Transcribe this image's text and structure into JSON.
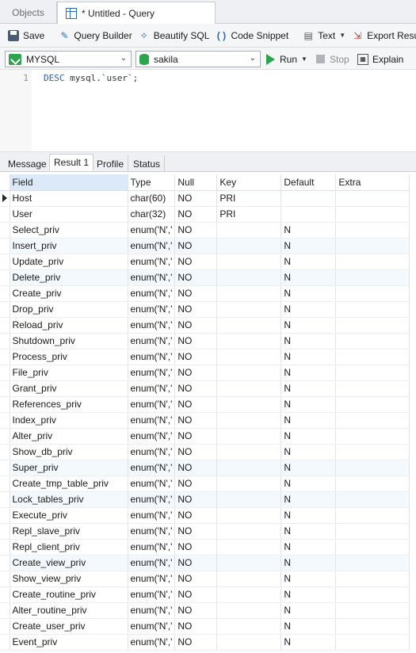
{
  "tabs": {
    "objects": "Objects",
    "query": "* Untitled - Query"
  },
  "toolbar": {
    "save": "Save",
    "query_builder": "Query Builder",
    "beautify": "Beautify SQL",
    "snippet": "Code Snippet",
    "text": "Text",
    "export": "Export Result"
  },
  "connection": {
    "name": "MYSQL",
    "database": "sakila",
    "run": "Run",
    "stop": "Stop",
    "explain": "Explain"
  },
  "editor": {
    "line": "1",
    "keyword": "DESC",
    "rest": " mysql.`user`;"
  },
  "result_tabs": [
    "Message",
    "Result 1",
    "Profile",
    "Status"
  ],
  "grid": {
    "columns": [
      "Field",
      "Type",
      "Null",
      "Key",
      "Default",
      "Extra"
    ],
    "rows": [
      [
        "Host",
        "char(60)",
        "NO",
        "PRI",
        "",
        ""
      ],
      [
        "User",
        "char(32)",
        "NO",
        "PRI",
        "",
        ""
      ],
      [
        "Select_priv",
        "enum('N','",
        "NO",
        "",
        "N",
        ""
      ],
      [
        "Insert_priv",
        "enum('N','",
        "NO",
        "",
        "N",
        ""
      ],
      [
        "Update_priv",
        "enum('N','",
        "NO",
        "",
        "N",
        ""
      ],
      [
        "Delete_priv",
        "enum('N','",
        "NO",
        "",
        "N",
        ""
      ],
      [
        "Create_priv",
        "enum('N','",
        "NO",
        "",
        "N",
        ""
      ],
      [
        "Drop_priv",
        "enum('N','",
        "NO",
        "",
        "N",
        ""
      ],
      [
        "Reload_priv",
        "enum('N','",
        "NO",
        "",
        "N",
        ""
      ],
      [
        "Shutdown_priv",
        "enum('N','",
        "NO",
        "",
        "N",
        ""
      ],
      [
        "Process_priv",
        "enum('N','",
        "NO",
        "",
        "N",
        ""
      ],
      [
        "File_priv",
        "enum('N','",
        "NO",
        "",
        "N",
        ""
      ],
      [
        "Grant_priv",
        "enum('N','",
        "NO",
        "",
        "N",
        ""
      ],
      [
        "References_priv",
        "enum('N','",
        "NO",
        "",
        "N",
        ""
      ],
      [
        "Index_priv",
        "enum('N','",
        "NO",
        "",
        "N",
        ""
      ],
      [
        "Alter_priv",
        "enum('N','",
        "NO",
        "",
        "N",
        ""
      ],
      [
        "Show_db_priv",
        "enum('N','",
        "NO",
        "",
        "N",
        ""
      ],
      [
        "Super_priv",
        "enum('N','",
        "NO",
        "",
        "N",
        ""
      ],
      [
        "Create_tmp_table_priv",
        "enum('N','",
        "NO",
        "",
        "N",
        ""
      ],
      [
        "Lock_tables_priv",
        "enum('N','",
        "NO",
        "",
        "N",
        ""
      ],
      [
        "Execute_priv",
        "enum('N','",
        "NO",
        "",
        "N",
        ""
      ],
      [
        "Repl_slave_priv",
        "enum('N','",
        "NO",
        "",
        "N",
        ""
      ],
      [
        "Repl_client_priv",
        "enum('N','",
        "NO",
        "",
        "N",
        ""
      ],
      [
        "Create_view_priv",
        "enum('N','",
        "NO",
        "",
        "N",
        ""
      ],
      [
        "Show_view_priv",
        "enum('N','",
        "NO",
        "",
        "N",
        ""
      ],
      [
        "Create_routine_priv",
        "enum('N','",
        "NO",
        "",
        "N",
        ""
      ],
      [
        "Alter_routine_priv",
        "enum('N','",
        "NO",
        "",
        "N",
        ""
      ],
      [
        "Create_user_priv",
        "enum('N','",
        "NO",
        "",
        "N",
        ""
      ],
      [
        "Event_priv",
        "enum('N','",
        "NO",
        "",
        "N",
        ""
      ]
    ]
  },
  "colors": {
    "accent": "#2f6db3",
    "run_green": "#2da44e",
    "selected_header": "#dbe9f8",
    "alt_row": "#f4f9fe"
  }
}
